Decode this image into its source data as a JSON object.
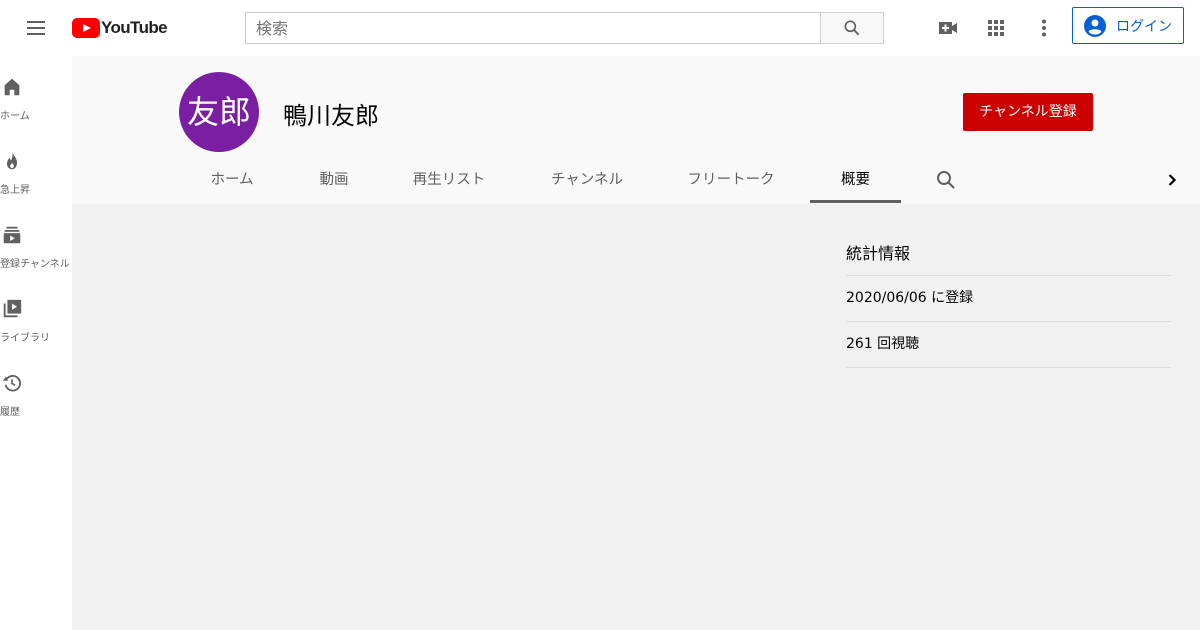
{
  "header": {
    "logo_text": "YouTube",
    "search_placeholder": "検索",
    "signin_label": "ログイン"
  },
  "sidebar": {
    "items": [
      {
        "label": "ホーム",
        "icon": "home-icon"
      },
      {
        "label": "急上昇",
        "icon": "trending-icon"
      },
      {
        "label": "登録チャンネル",
        "icon": "subscriptions-icon"
      },
      {
        "label": "ライブラリ",
        "icon": "library-icon"
      },
      {
        "label": "履歴",
        "icon": "history-icon"
      }
    ]
  },
  "channel": {
    "avatar_text": "友郎",
    "avatar_color": "#7b1fa2",
    "name": "鴨川友郎",
    "subscribe_label": "チャンネル登録",
    "subscribe_color": "#cc0000"
  },
  "tabs": [
    {
      "label": "ホーム",
      "active": false
    },
    {
      "label": "動画",
      "active": false
    },
    {
      "label": "再生リスト",
      "active": false
    },
    {
      "label": "チャンネル",
      "active": false
    },
    {
      "label": "フリートーク",
      "active": false
    },
    {
      "label": "概要",
      "active": true
    }
  ],
  "stats": {
    "title": "統計情報",
    "joined": "2020/06/06 に登録",
    "views": "261 回視聴"
  }
}
